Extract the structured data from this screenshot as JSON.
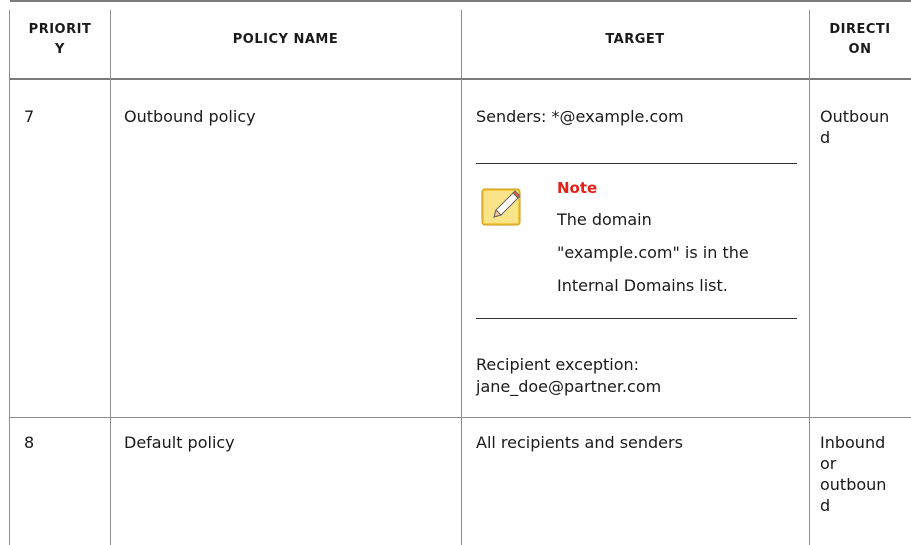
{
  "columns": {
    "priority": "PRIORITY",
    "policy_name": "POLICY NAME",
    "target": "TARGET",
    "direction": "DIRECTION"
  },
  "headers_display": {
    "priority_line1": "PRIORIT",
    "priority_line2": "Y",
    "policy_name": "POLICY NAME",
    "target": "TARGET",
    "direction_line1": "DIRECTI",
    "direction_line2": "ON"
  },
  "rows": [
    {
      "priority": "7",
      "policy_name": "Outbound policy",
      "target_senders": "Senders: *@example.com",
      "note": {
        "title": "Note",
        "text_line1": "The domain",
        "text_line2": "\"example.com\" is in the",
        "text_line3": "Internal Domains list."
      },
      "target_exception_line1": "Recipient exception:",
      "target_exception_line2": "jane_doe@partner.com",
      "direction_line1": "Outboun",
      "direction_line2": "d"
    },
    {
      "priority": "8",
      "policy_name": "Default policy",
      "target": "All recipients and senders",
      "direction_line1": "Inbound",
      "direction_line2": "or",
      "direction_line3": "outboun",
      "direction_line4": "d"
    }
  ],
  "colors": {
    "note_title": "#e2231a",
    "note_icon_bg": "#f5c842",
    "rule": "#8c8c8c"
  },
  "icons": {
    "note": "note-pencil-icon"
  }
}
